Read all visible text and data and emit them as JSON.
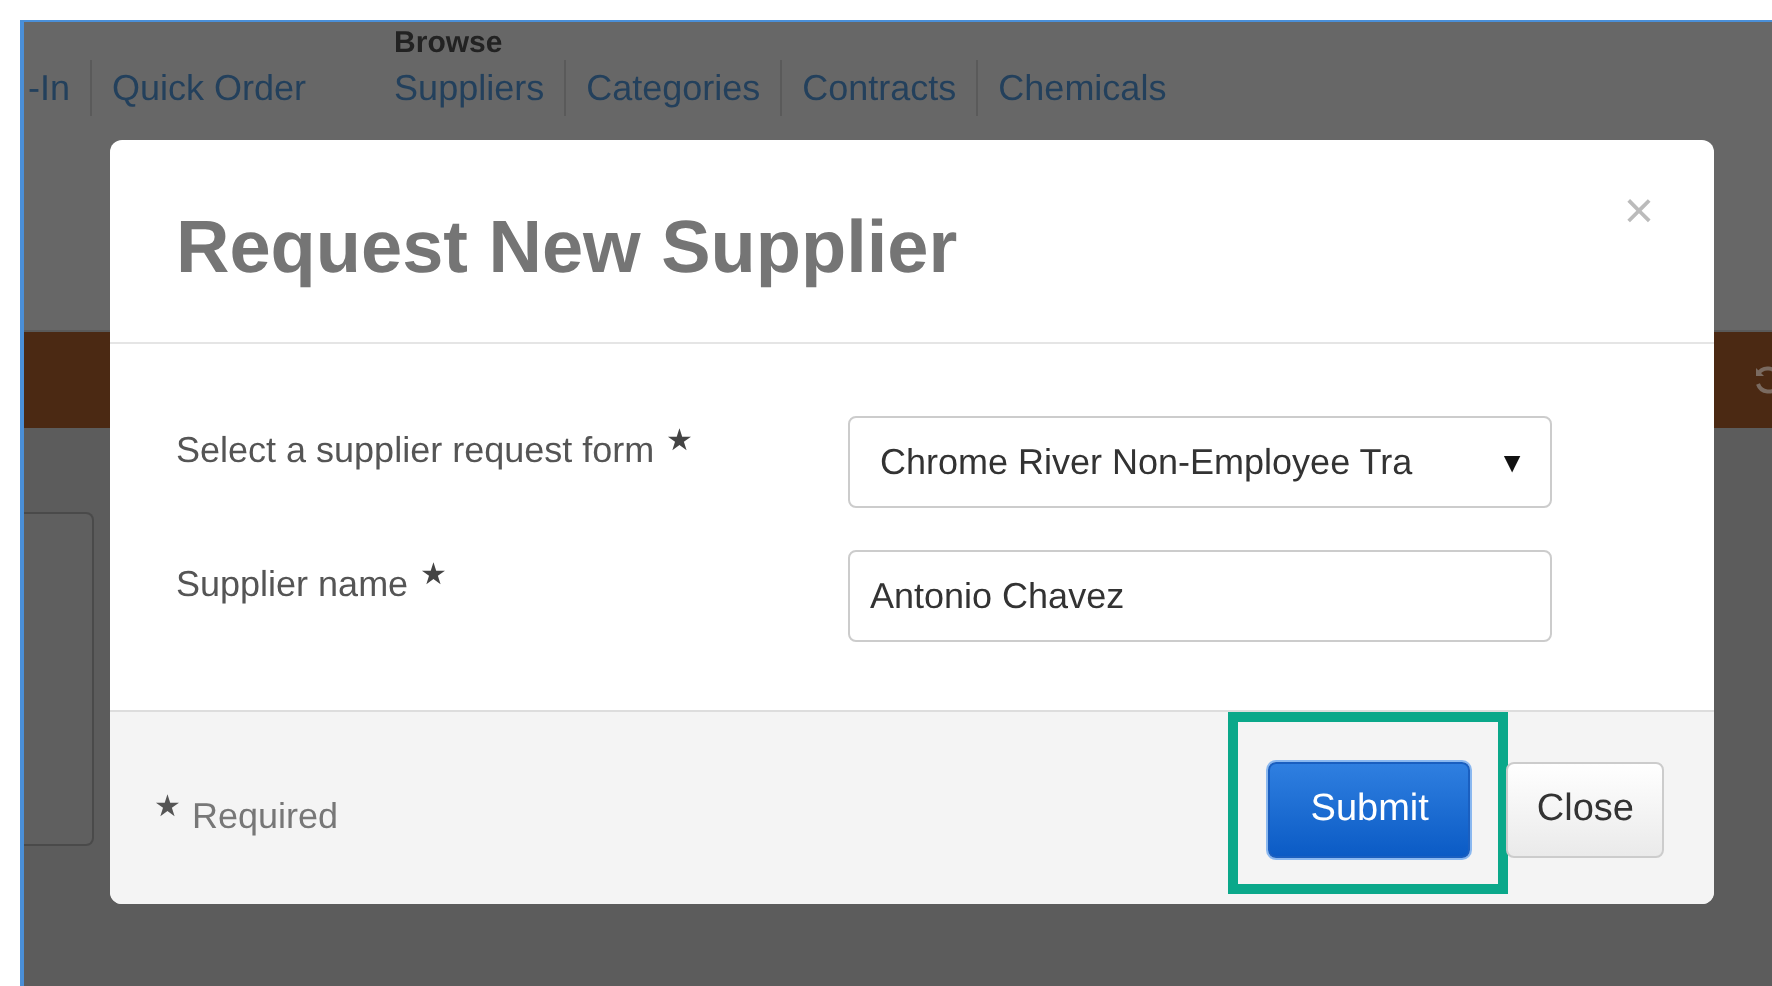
{
  "nav": {
    "partial_link": "-In",
    "links": [
      {
        "label": "Quick Order"
      }
    ],
    "browse": {
      "heading": "Browse",
      "links": [
        {
          "label": "Suppliers"
        },
        {
          "label": "Categories"
        },
        {
          "label": "Contracts"
        },
        {
          "label": "Chemicals"
        }
      ]
    }
  },
  "dialog": {
    "title": "Request New Supplier",
    "close": "×",
    "fields": [
      {
        "kind": "select",
        "label": "Select a supplier request form",
        "required_mark": "★",
        "value": "Chrome River Non-Employee Tra",
        "caret": "▼"
      },
      {
        "kind": "text",
        "label": "Supplier name",
        "required_mark": "★",
        "value": "Antonio Chavez"
      }
    ],
    "footer": {
      "required_mark": "★",
      "required_note": "Required"
    },
    "buttons": [
      {
        "label": "Submit",
        "kind": "primary",
        "highlighted": true
      },
      {
        "label": "Close",
        "kind": "default",
        "highlighted": false
      }
    ]
  }
}
